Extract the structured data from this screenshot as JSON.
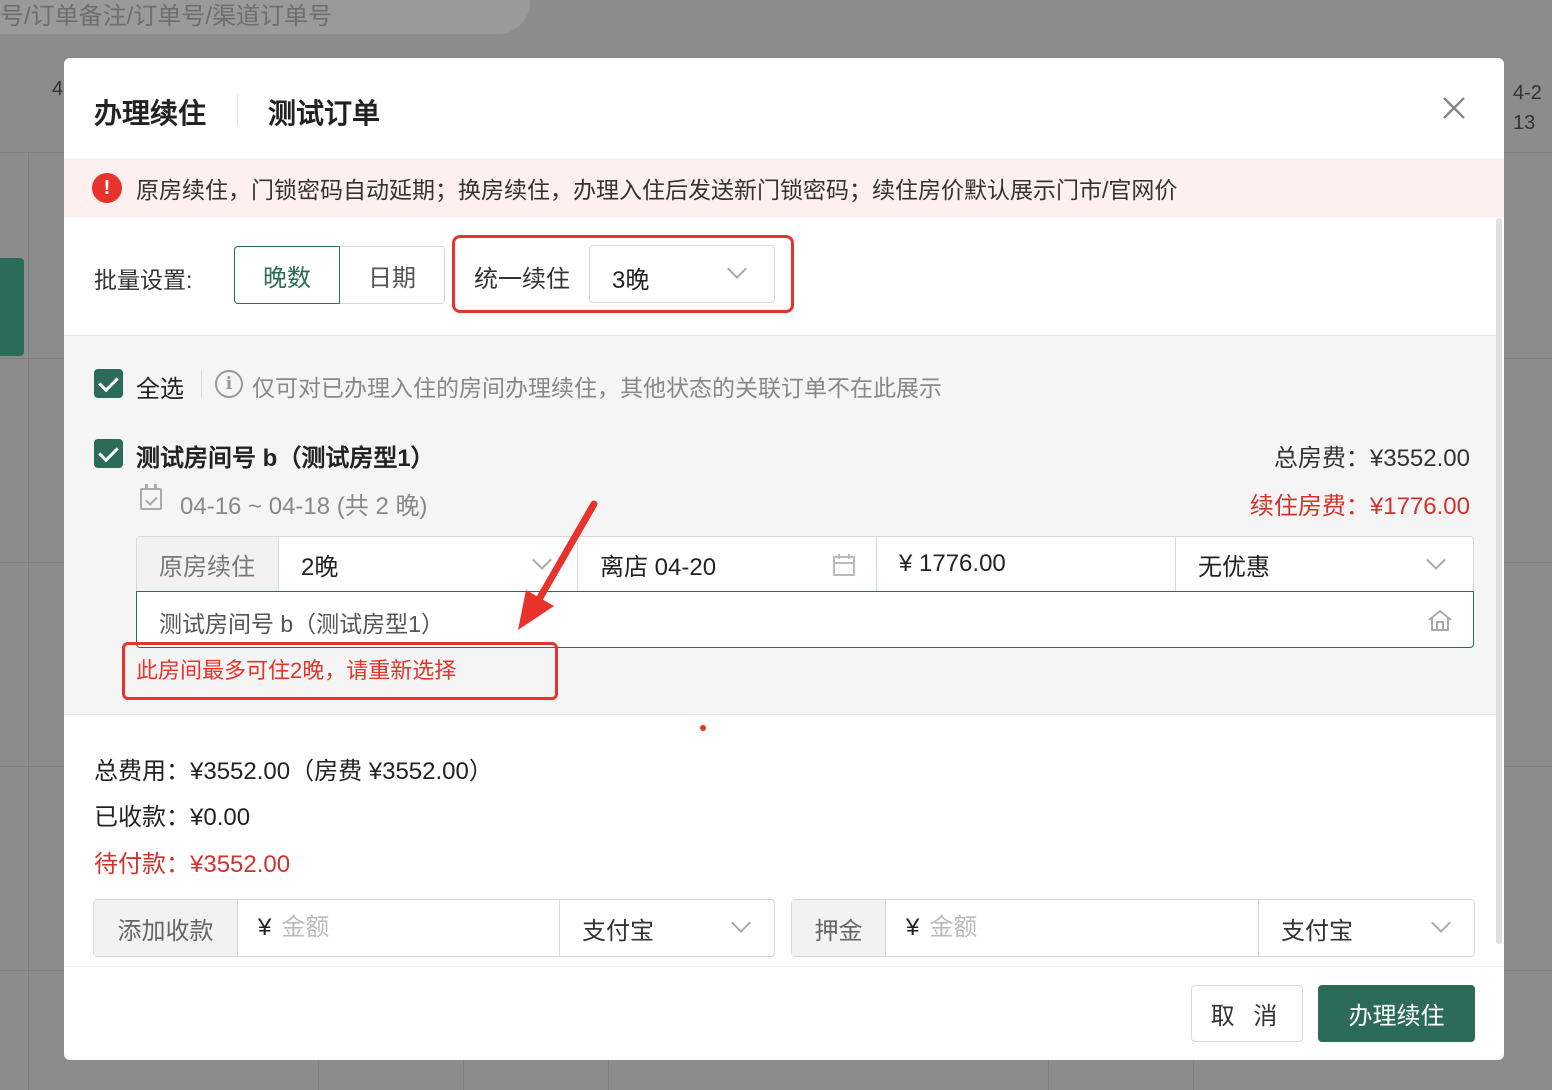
{
  "background": {
    "search_placeholder": "号/订单备注/订单号/渠道订单号",
    "date_left": "4",
    "date_right_line1": "4-2",
    "date_right_line2": "13"
  },
  "modal": {
    "title": "办理续住",
    "subtitle": "测试订单",
    "alert": "原房续住，门锁密码自动延期；换房续住，办理入住后发送新门锁密码；续住房价默认展示门市/官网价",
    "batch": {
      "label": "批量设置:",
      "tab_nights": "晚数",
      "tab_date": "日期",
      "active_tab": "晚数",
      "unified_label": "统一续住",
      "unified_value": "3晚"
    },
    "select_all_label": "全选",
    "info_text": "仅可对已办理入住的房间办理续住，其他状态的关联订单不在此展示",
    "room": {
      "title": "测试房间号 b（测试房型1）",
      "total_room_fee": "总房费：¥3552.00",
      "renew_room_fee": "续住房费：¥1776.00",
      "date_range": "04-16 ~ 04-18 (共 2 晚)",
      "mode_label": "原房续住",
      "nights_value": "2晚",
      "depart_value": "离店 04-20",
      "price_value": "¥ 1776.00",
      "discount_value": "无优惠",
      "room_select_value": "测试房间号 b（测试房型1）",
      "error": "此房间最多可住2晚，请重新选择"
    },
    "totals": {
      "total": "总费用：¥3552.00（房费 ¥3552.00）",
      "received": "已收款：¥0.00",
      "pending": "待付款：¥3552.00"
    },
    "payment": {
      "add_label": "添加收款",
      "add_currency": "¥",
      "add_placeholder": "金额",
      "add_method": "支付宝",
      "deposit_label": "押金",
      "deposit_currency": "¥",
      "deposit_placeholder": "金额",
      "deposit_method": "支付宝"
    },
    "buttons": {
      "cancel": "取 消",
      "submit": "办理续住"
    }
  },
  "colors": {
    "brand_green": "#2b6b57",
    "alert_red": "#e8322c",
    "fee_red": "#d0332c"
  }
}
